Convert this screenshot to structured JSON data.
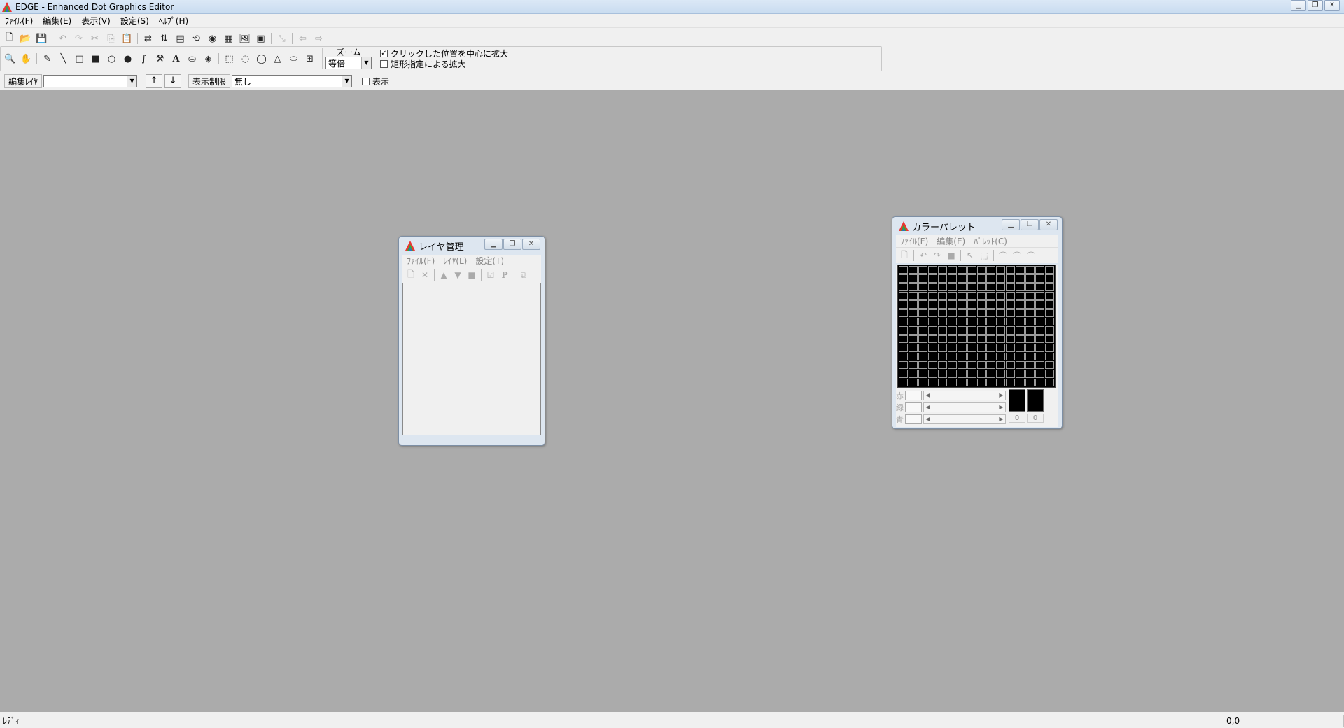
{
  "window": {
    "title": "EDGE - Enhanced Dot Graphics Editor",
    "controls": [
      "minimize",
      "maximize",
      "close"
    ]
  },
  "menubar": {
    "items": [
      "ﾌｧｲﾙ(F)",
      "編集(E)",
      "表示(V)",
      "設定(S)",
      "ﾍﾙﾌﾟ(H)"
    ]
  },
  "toolbar": {
    "zoom_label": "ズーム",
    "zoom_value": "等倍",
    "click_zoom_label": "クリックした位置を中心に拡大",
    "click_zoom_checked": true,
    "rect_zoom_label": "矩形指定による拡大",
    "rect_zoom_checked": false
  },
  "layerbar": {
    "edit_layer_label": "編集ﾚｲﾔ",
    "edit_layer_value": "",
    "up_label": "↑",
    "down_label": "↓",
    "display_limit_label": "表示制限",
    "display_limit_value": "無し",
    "show_label": "表示",
    "show_checked": false
  },
  "layer_window": {
    "title": "レイヤ管理",
    "menu": [
      "ﾌｧｲﾙ(F)",
      "ﾚｲﾔ(L)",
      "設定(T)"
    ]
  },
  "palette_window": {
    "title": "カラーパレット",
    "menu": [
      "ﾌｧｲﾙ(F)",
      "編集(E)",
      "ﾊﾟﾚｯﾄ(C)"
    ],
    "red_label": "赤",
    "green_label": "緑",
    "blue_label": "青",
    "fg_index": "0",
    "bg_index": "0"
  },
  "statusbar": {
    "message": "ﾚﾃﾞｨ",
    "coords": "0,0"
  }
}
